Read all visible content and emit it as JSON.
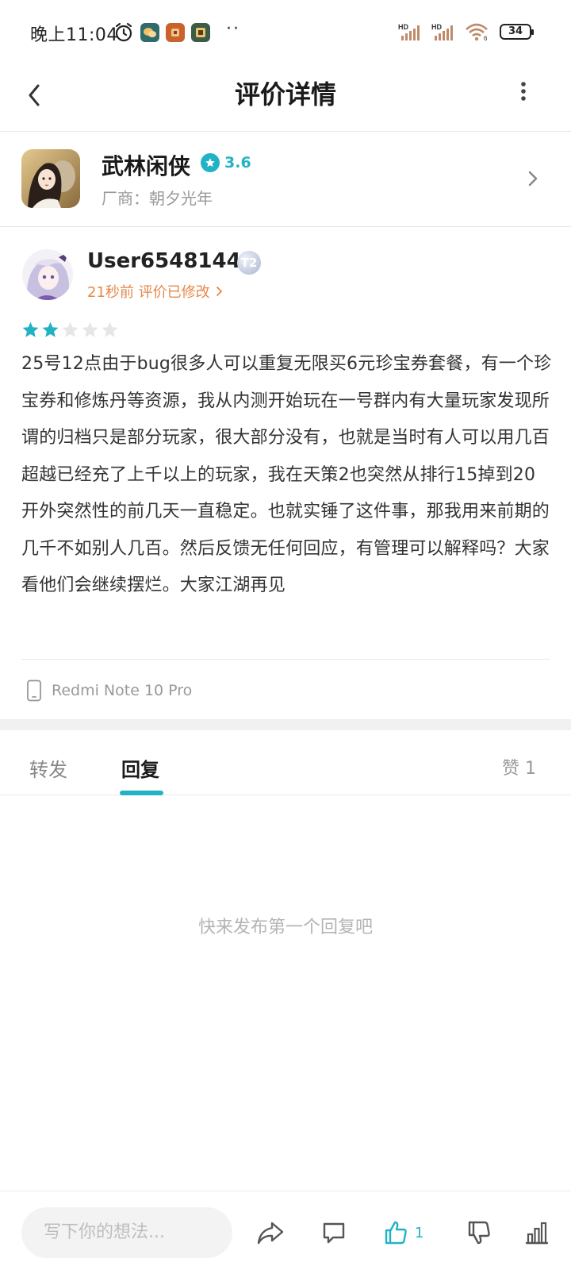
{
  "status_bar": {
    "time": "晚上11:04",
    "more_dots": "··",
    "battery": "34",
    "network_label": "HD"
  },
  "header": {
    "title": "评价详情"
  },
  "game": {
    "name": "武林闲侠",
    "rating": "3.6",
    "vendor": "厂商：朝夕光年"
  },
  "review": {
    "username": "User65481442",
    "level_badge": "T2",
    "meta": "21秒前 评价已修改",
    "stars": 2,
    "max_stars": 5,
    "text": "25号12点由于bug很多人可以重复无限买6元珍宝券套餐，有一个珍宝券和修炼丹等资源，我从内测开始玩在一号群内有大量玩家发现所谓的归档只是部分玩家，很大部分没有，也就是当时有人可以用几百超越已经充了上千以上的玩家，我在天策2也突然从排行15掉到20开外突然性的前几天一直稳定。也就实锤了这件事，那我用来前期的几千不如别人几百。然后反馈无任何回应，有管理可以解释吗？大家看他们会继续摆烂。大家江湖再见",
    "device": "Redmi Note 10 Pro"
  },
  "tabs": {
    "forward": "转发",
    "reply": "回复",
    "likes": "赞 1"
  },
  "empty_state": "快来发布第一个回复吧",
  "bottom_bar": {
    "input_placeholder": "写下你的想法...",
    "like_count": "1"
  },
  "colors": {
    "accent": "#21b3c5",
    "meta_orange": "#e5884a",
    "star_off": "#e6e6e6"
  }
}
